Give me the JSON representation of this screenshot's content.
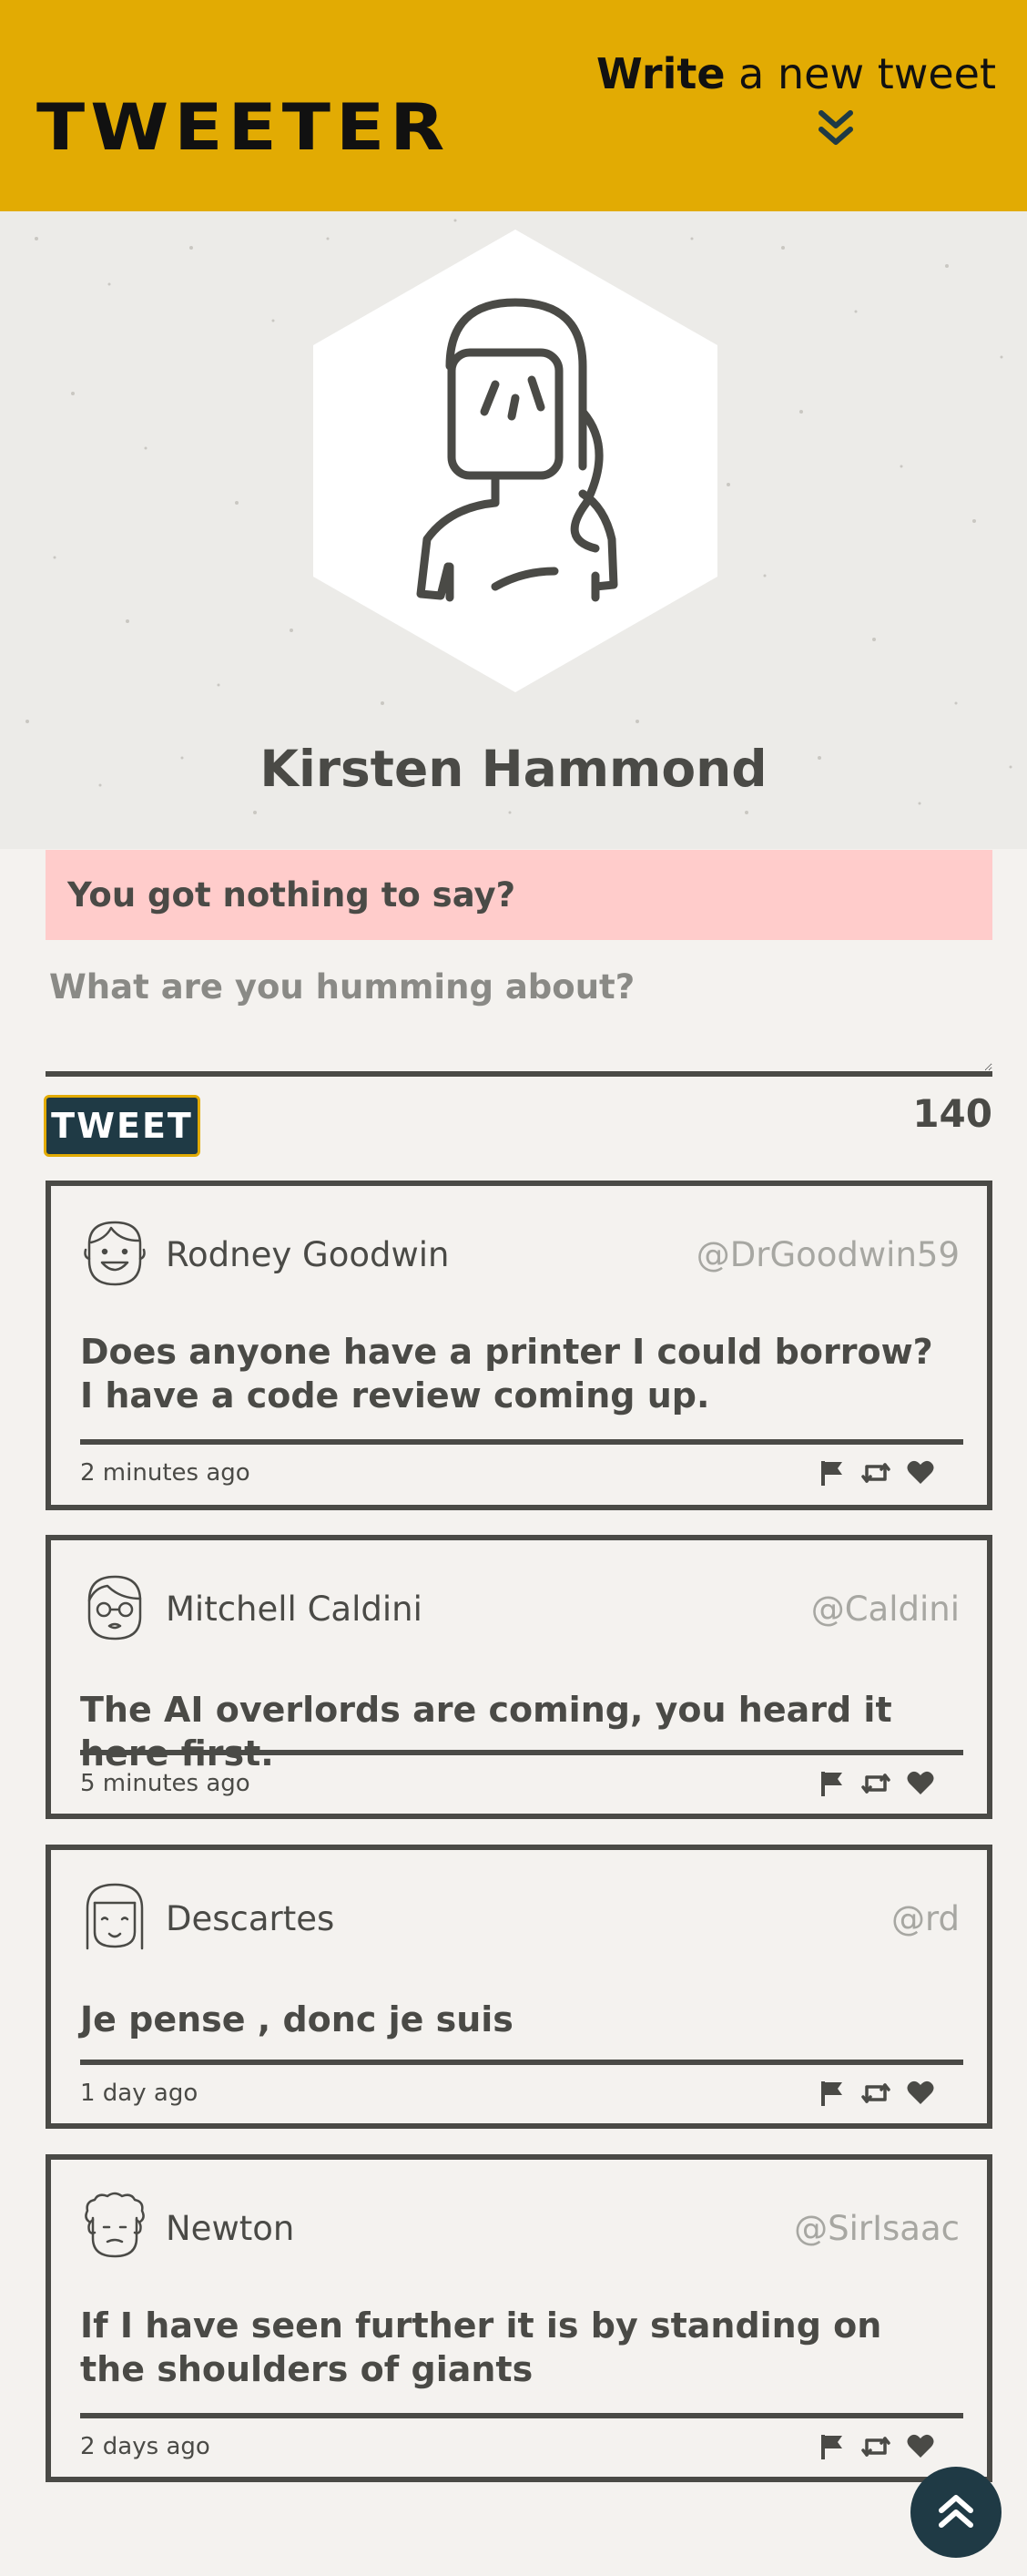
{
  "header": {
    "logo": "TWEETER",
    "write_bold": "Write",
    "write_rest": " a new tweet"
  },
  "profile": {
    "name": "Kirsten Hammond"
  },
  "compose": {
    "alert": "You got nothing to say?",
    "placeholder": "What are you humming about?",
    "button_label": "TWEET",
    "counter": "140"
  },
  "tweets": [
    {
      "name": "Rodney Goodwin",
      "handle": "@DrGoodwin59",
      "text": "Does anyone have a printer I could borrow? I have a code review coming up.",
      "time": "2 minutes ago"
    },
    {
      "name": "Mitchell Caldini",
      "handle": "@Caldini",
      "text": "The AI overlords are coming, you heard it here first.",
      "time": "5 minutes ago"
    },
    {
      "name": "Descartes",
      "handle": "@rd",
      "text": "Je pense , donc je suis",
      "time": "1 day ago"
    },
    {
      "name": "Newton",
      "handle": "@SirIsaac",
      "text": "If I have seen further it is by standing on the shoulders of giants",
      "time": "2 days ago"
    }
  ],
  "icons": {
    "flag": "flag-icon",
    "retweet": "retweet-icon",
    "like": "heart-icon",
    "scroll_top": "double-chevron-up-icon",
    "write": "double-chevron-down-icon"
  },
  "colors": {
    "header_bg": "#e2ab03",
    "accent_dark": "#1f3a45",
    "alert_bg": "#ffcccb",
    "text": "#4a4a46"
  }
}
